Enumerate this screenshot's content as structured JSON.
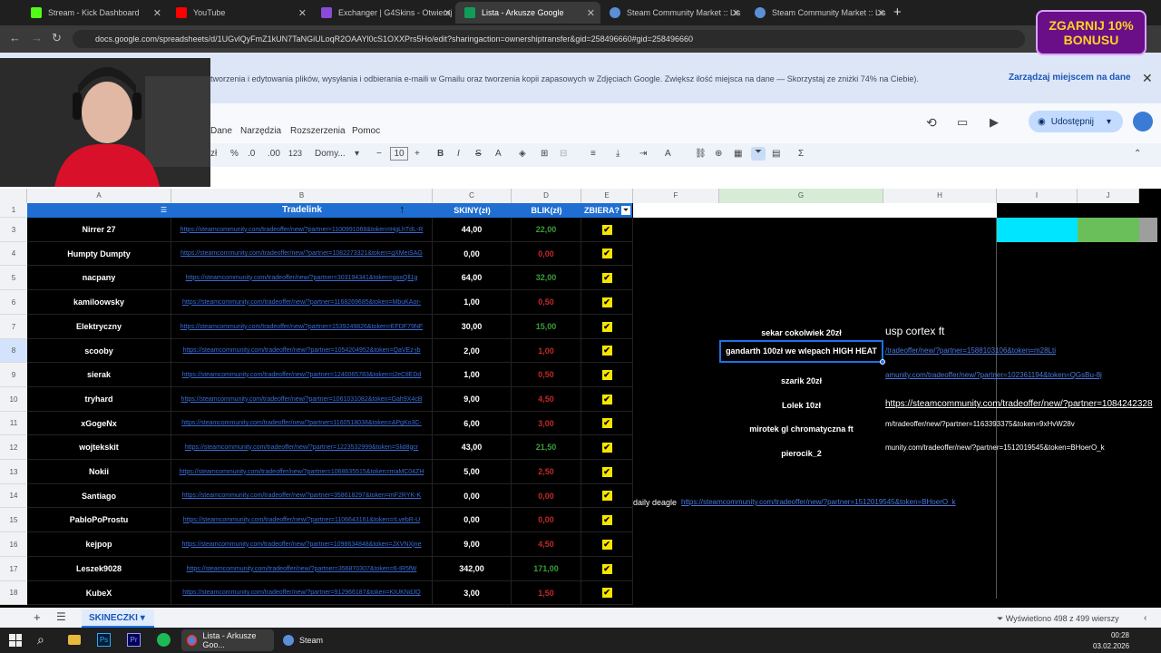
{
  "browser": {
    "tabs": [
      {
        "label": "Stream - Kick Dashboard",
        "color": "#53fc18"
      },
      {
        "label": "YouTube",
        "color": "#ff0000"
      },
      {
        "label": "Exchanger | G4Skins - Otwieraj",
        "color": "#8a4bd8"
      },
      {
        "label": "Lista - Arkusze Google",
        "color": "#0f9d58"
      },
      {
        "label": "Steam Community Market :: Lis",
        "color": "#1b2838"
      },
      {
        "label": "Steam Community Market :: Lis",
        "color": "#1b2838"
      }
    ],
    "url": "docs.google.com/spreadsheets/d/1UGvlQyFmZ1kUN7TaNGiULoqR2OAAYl0cS1OXXPrs5Ho/edit?sharingaction=ownershiptransfer&gid=258496660#gid=258496660",
    "ad": "ZGARNIJ 10% BONUSU"
  },
  "banner": {
    "text": "tworzenia i edytowania plików, wysyłania i odbierania e-maili w Gmailu oraz tworzenia kopii zapasowych w Zdjęciach Google. Zwiększ ilość miejsca na dane — Skorzystaj ze zniżki 74% na Ciebie).",
    "link": "Zarządzaj miejscem na dane"
  },
  "menu": [
    "Dane",
    "Narzędzia",
    "Rozszerzenia",
    "Pomoc"
  ],
  "share_label": "Udostępnij",
  "toolbar": {
    "zoom_label": "zł",
    "percent": "%",
    "dec_minus": ".0",
    "dec_plus": ".00",
    "fmt": "123",
    "font": "Domy...",
    "size": "10"
  },
  "columns": [
    "A",
    "B",
    "C",
    "D",
    "E",
    "F",
    "G",
    "H",
    "I",
    "J"
  ],
  "headers": {
    "b": "Tradelink",
    "c": "SKINY(zł)",
    "d": "BLIK(zł)",
    "e": "ZBIERA?"
  },
  "rows": [
    {
      "n": "3",
      "name": "Nirrer 27",
      "link": "https://steamcommunity.com/tradeoffer/new/?partner=1100991068&token=HgLhTdL-R",
      "skiny": "44,00",
      "blik": "22,00",
      "blik_pos": true
    },
    {
      "n": "4",
      "name": "Humpty Dumpty",
      "link": "https://steamcommunity.com/tradeoffer/new/?partner=1082273321&token=gXMeiSAG",
      "skiny": "0,00",
      "blik": "0,00",
      "blik_pos": false
    },
    {
      "n": "5",
      "name": "nacpany",
      "link": "https://steamcommunity.com/tradeoffer/new/?partner=303194341&token=goxQll1g",
      "skiny": "64,00",
      "blik": "32,00",
      "blik_pos": true
    },
    {
      "n": "6",
      "name": "kamiloowsky",
      "link": "https://steamcommunity.com/tradeoffer/new/?partner=1168269685&token=MbuKAor-",
      "skiny": "1,00",
      "blik": "0,50",
      "blik_pos": false
    },
    {
      "n": "7",
      "name": "Elektryczny",
      "link": "https://steamcommunity.com/tradeoffer/new/?partner=1539249826&token=EFDF79NF",
      "skiny": "30,00",
      "blik": "15,00",
      "blik_pos": true
    },
    {
      "n": "8",
      "name": "scooby",
      "link": "https://steamcommunity.com/tradeoffer/new/?partner=1054204952&token=QaVEz-jb",
      "skiny": "2,00",
      "blik": "1,00",
      "blik_pos": false
    },
    {
      "n": "9",
      "name": "sierak",
      "link": "https://steamcommunity.com/tradeoffer/new/?partner=1240065783&token=i2eCtlEDd",
      "skiny": "1,00",
      "blik": "0,50",
      "blik_pos": false
    },
    {
      "n": "10",
      "name": "tryhard",
      "link": "https://steamcommunity.com/tradeoffer/new/?partner=1061031082&token=Gah9X4cB",
      "skiny": "9,00",
      "blik": "4,50",
      "blik_pos": false
    },
    {
      "n": "11",
      "name": "xGogeNx",
      "link": "https://steamcommunity.com/tradeoffer/new/?partner=1160518038&token=APgKo3C-",
      "skiny": "6,00",
      "blik": "3,00",
      "blik_pos": false
    },
    {
      "n": "12",
      "name": "wojtekskit",
      "link": "https://steamcommunity.com/tradeoffer/new/?partner=1223532999&token=Slid8gcr",
      "skiny": "43,00",
      "blik": "21,50",
      "blik_pos": true
    },
    {
      "n": "13",
      "name": "Nokii",
      "link": "https://steamcommunity.com/tradeoffer/new/?partner=1068635515&token=maMC04ZH",
      "skiny": "5,00",
      "blik": "2,50",
      "blik_pos": false
    },
    {
      "n": "14",
      "name": "Santiago",
      "link": "https://steamcommunity.com/tradeoffer/new/?partner=358618297&token=mF2RYK-K",
      "skiny": "0,00",
      "blik": "0,00",
      "blik_pos": false
    },
    {
      "n": "15",
      "name": "PabloPoProstu",
      "link": "https://steamcommunity.com/tradeoffer/new/?partner=1106643161&token=rLvebR-U",
      "skiny": "0,00",
      "blik": "0,00",
      "blik_pos": false
    },
    {
      "n": "16",
      "name": "kejpop",
      "link": "https://steamcommunity.com/tradeoffer/new/?partner=1098634848&token=JXVNXjne",
      "skiny": "9,00",
      "blik": "4,50",
      "blik_pos": false
    },
    {
      "n": "17",
      "name": "Leszek9028",
      "link": "https://steamcommunity.com/tradeoffer/new/?partner=356870307&token=6-IR5fW",
      "skiny": "342,00",
      "blik": "171,00",
      "blik_pos": true
    },
    {
      "n": "18",
      "name": "KubeX",
      "link": "https://steamcommunity.com/tradeoffer/new/?partner=912966187&token=KIUKNdJQ",
      "skiny": "3,00",
      "blik": "1,50",
      "blik_pos": false
    }
  ],
  "side_items": [
    {
      "text": "sekar cokolwiek 20zł"
    },
    {
      "text": "gandarth 100zł we wlepach HIGH HEAT"
    },
    {
      "text": "szarik 20zł"
    },
    {
      "text": "Lolek 10zł"
    },
    {
      "text": "mirotek gl chromatyczna ft"
    },
    {
      "text": "pierocik_2"
    }
  ],
  "side_usp": "usp cortex ft",
  "side_links": [
    "/tradeoffer/new/?partner=1588103106&token=m28Lti",
    "amunity.com/tradeoffer/new/?partner=102361194&token=QGsBu-8j",
    "https://steamcommunity.com/tradeoffer/new/?partner=1084242328",
    "m/tradeoffer/new/?partner=1163393375&token=9xHvW28v",
    "munity.com/tradeoffer/new/?partner=1512019545&token=BHoerO_k"
  ],
  "daily_text": "daily deagle",
  "daily_link": "https://steamcommunity.com/tradeoffer/new/?partner=1512019545&token=BHoerO_k",
  "sheet_tab": "SKINECZKI",
  "sheet_info": "Wyświetlono 498 z 499 wierszy",
  "taskbar": {
    "chrome": "Lista - Arkusze Goo...",
    "steam": "Steam",
    "time": "00:28",
    "date": "03.02.2026"
  },
  "colors": {
    "cyan": "#00e5ff",
    "green": "#6abf5a",
    "gray": "#9e9e9e",
    "header_blue": "#1f6fd3"
  }
}
